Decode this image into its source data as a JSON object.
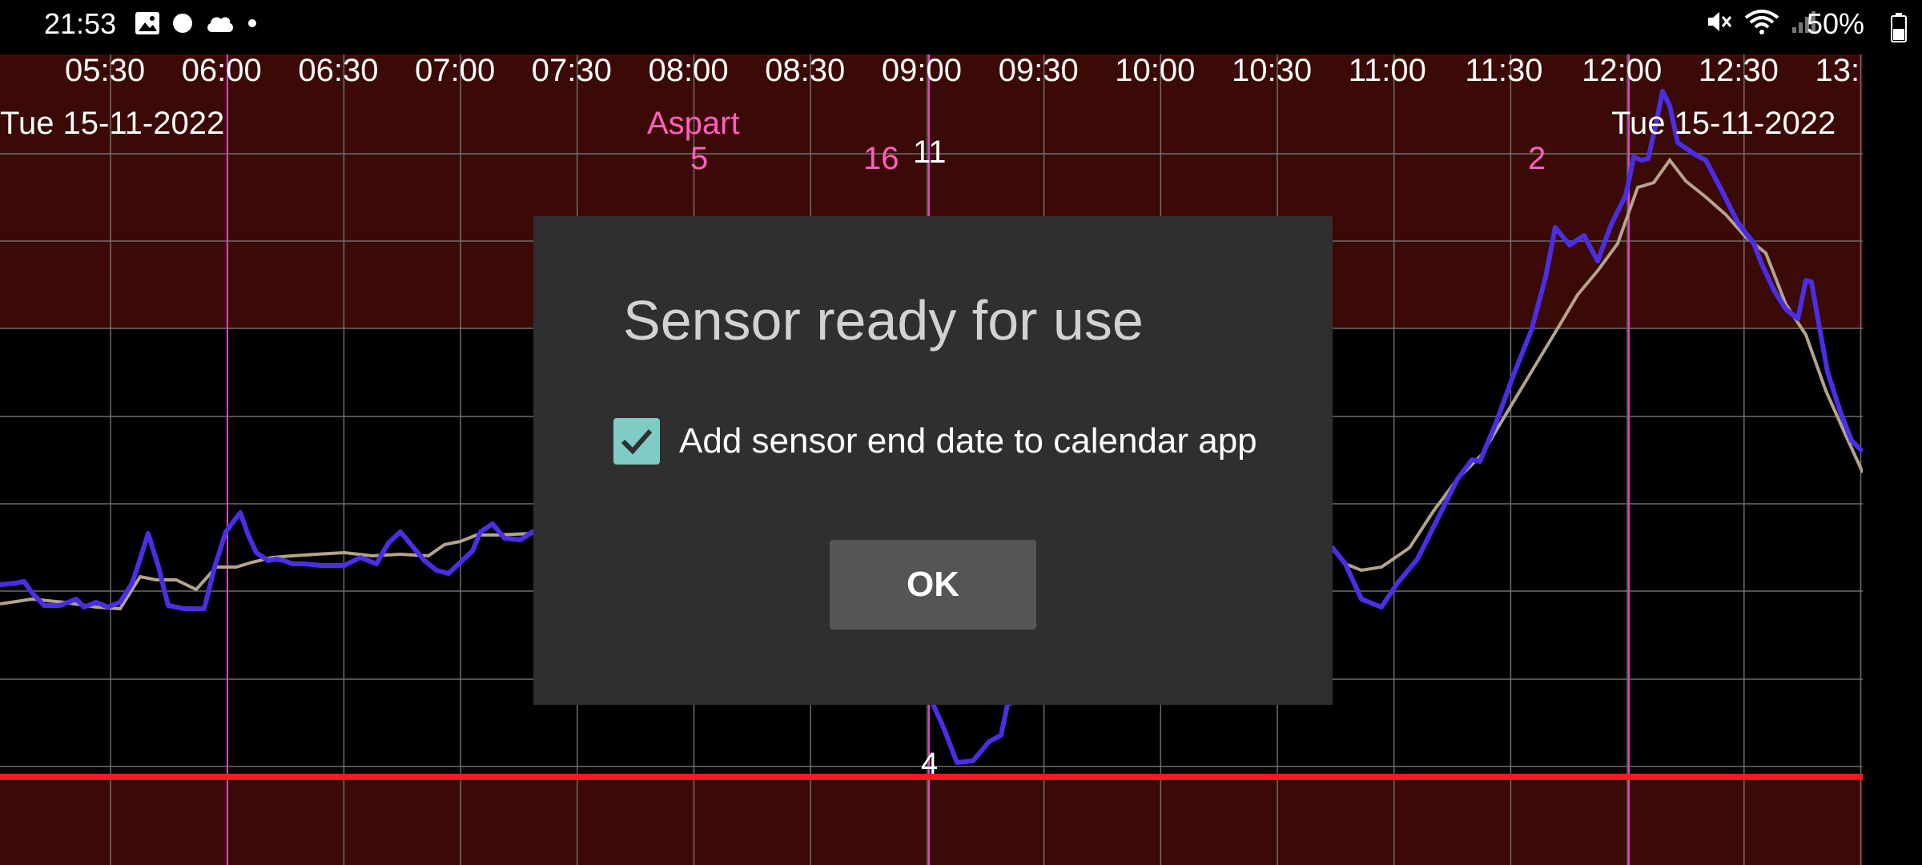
{
  "status_bar": {
    "time": "21:53",
    "battery": "50%",
    "left_icons": [
      "image-icon",
      "circle-icon",
      "cloud-icon",
      "dot-icon"
    ],
    "right_icons": [
      "mute-icon",
      "wifi-icon",
      "signal-icon",
      "battery-icon"
    ]
  },
  "graph": {
    "time_labels": [
      "05:30",
      "06:00",
      "06:30",
      "07:00",
      "07:30",
      "08:00",
      "08:30",
      "09:00",
      "09:30",
      "10:00",
      "10:30",
      "11:00",
      "11:30",
      "12:00",
      "12:30",
      "13:"
    ],
    "date_left": "Tue 15-11-2022",
    "date_right": "Tue 15-11-2022",
    "insulin_name": "Aspart",
    "insulin_doses": [
      {
        "label": "5"
      },
      {
        "label": "16"
      },
      {
        "label": "2"
      }
    ],
    "carb_label": "11",
    "low_label": "4",
    "colors": {
      "high_zone": "#3c0a06",
      "target_zone": "#000000",
      "glucose_line": "#4a2ee6",
      "trend_line": "#b4a48c",
      "insulin": "#ff5fbf",
      "low_line": "#ff1a1a",
      "grid": "#7a7a7a"
    }
  },
  "dialog": {
    "title": "Sensor ready for use",
    "checkbox_label": "Add sensor end date to calendar app",
    "checkbox_checked": true,
    "ok_label": "OK"
  }
}
